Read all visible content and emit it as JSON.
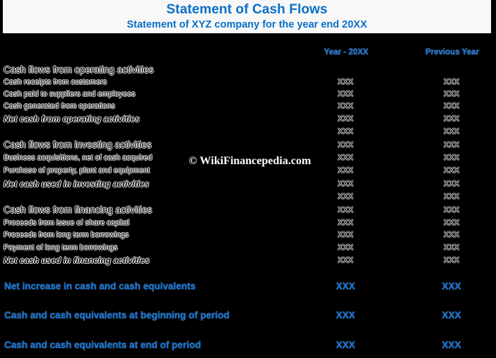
{
  "header": {
    "title": "Statement of Cash Flows",
    "subtitle": "Statement of XYZ company for the year end 20XX"
  },
  "columns": [
    "Year - 20XX",
    "Previous Year"
  ],
  "rows": [
    {
      "label": "Cash flows from operating activities",
      "type": "section",
      "values": [
        "",
        ""
      ]
    },
    {
      "label": "Cash receipts from customers",
      "type": "item",
      "values": [
        "XXX",
        "XXX"
      ]
    },
    {
      "label": "Cash paid to suppliers and employees",
      "type": "item",
      "values": [
        "XXX",
        "XXX"
      ]
    },
    {
      "label": "Cash generated from operations",
      "type": "item",
      "values": [
        "XXX",
        "XXX"
      ]
    },
    {
      "label": "Net cash from operating activities",
      "type": "total",
      "values": [
        "XXX",
        "XXX"
      ]
    },
    {
      "label": "",
      "type": "blank",
      "values": [
        "XXX",
        "XXX"
      ]
    },
    {
      "label": "Cash flows from investing activities",
      "type": "section",
      "values": [
        "XXX",
        "XXX"
      ]
    },
    {
      "label": "Business acquisitions, net of cash acquired",
      "type": "item",
      "values": [
        "XXX",
        "XXX"
      ]
    },
    {
      "label": "Purchase of property, plant and equipment",
      "type": "item",
      "values": [
        "XXX",
        "XXX"
      ]
    },
    {
      "label": "Net cash used in investing activities",
      "type": "total",
      "values": [
        "XXX",
        "XXX"
      ]
    },
    {
      "label": "",
      "type": "blank",
      "values": [
        "XXX",
        "XXX"
      ]
    },
    {
      "label": "Cash flows from financing activities",
      "type": "section",
      "values": [
        "XXX",
        "XXX"
      ]
    },
    {
      "label": "Proceeds from issue of share capital",
      "type": "item",
      "values": [
        "XXX",
        "XXX"
      ]
    },
    {
      "label": "Proceeds from long term borrowings",
      "type": "item",
      "values": [
        "XXX",
        "XXX"
      ]
    },
    {
      "label": "Payment of long term borrowings",
      "type": "item",
      "values": [
        "XXX",
        "XXX"
      ]
    },
    {
      "label": "Net cash used in financing activities",
      "type": "total",
      "values": [
        "XXX",
        "XXX"
      ]
    }
  ],
  "summary": [
    {
      "label": "Net increase in cash and cash equivalents",
      "values": [
        "XXX",
        "XXX"
      ]
    },
    {
      "label": "Cash and cash equivalents at beginning of period",
      "values": [
        "XXX",
        "XXX"
      ]
    },
    {
      "label": "Cash and cash equivalents at end of period",
      "values": [
        "XXX",
        "XXX"
      ]
    }
  ],
  "watermark": "© WikiFinancepedia.com",
  "colors": {
    "accent": "#0a6fc8",
    "banner_bg": "#f8f8f8",
    "page_bg": "#000000"
  }
}
